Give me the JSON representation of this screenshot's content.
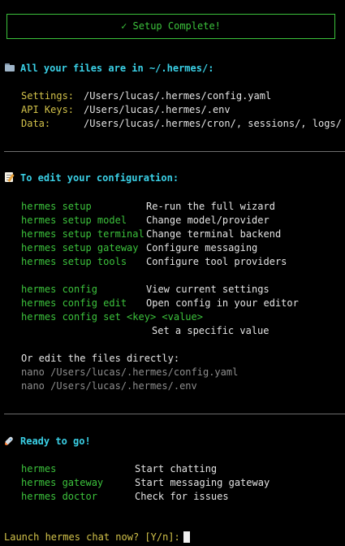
{
  "banner": {
    "text": "✓ Setup Complete!"
  },
  "files": {
    "heading": "All your files are in ~/.hermes/:",
    "icon": "folder-icon",
    "rows": [
      {
        "label": "Settings:",
        "value": "/Users/lucas/.hermes/config.yaml"
      },
      {
        "label": "API Keys:",
        "value": "/Users/lucas/.hermes/.env"
      },
      {
        "label": "Data:",
        "value": "/Users/lucas/.hermes/cron/, sessions/, logs/"
      }
    ]
  },
  "edit": {
    "heading": "To edit your configuration:",
    "icon": "memo-icon",
    "setup_commands": [
      {
        "cmd": "hermes setup",
        "desc": "Re-run the full wizard"
      },
      {
        "cmd": "hermes setup model",
        "desc": "Change model/provider"
      },
      {
        "cmd": "hermes setup terminal",
        "desc": "Change terminal backend"
      },
      {
        "cmd": "hermes setup gateway",
        "desc": "Configure messaging"
      },
      {
        "cmd": "hermes setup tools",
        "desc": "Configure tool providers"
      }
    ],
    "config_commands": [
      {
        "cmd": "hermes config",
        "desc": "View current settings"
      },
      {
        "cmd": "hermes config edit",
        "desc": "Open config in your editor"
      }
    ],
    "config_set": {
      "cmd": "hermes config set <key> <value>",
      "desc": "Set a specific value"
    },
    "direct_note": "Or edit the files directly:",
    "direct_commands": [
      "nano /Users/lucas/.hermes/config.yaml",
      "nano /Users/lucas/.hermes/.env"
    ]
  },
  "ready": {
    "heading": "Ready to go!",
    "icon": "rocket-icon",
    "commands": [
      {
        "cmd": "hermes",
        "desc": "Start chatting"
      },
      {
        "cmd": "hermes gateway",
        "desc": "Start messaging gateway"
      },
      {
        "cmd": "hermes doctor",
        "desc": "Check for issues"
      }
    ]
  },
  "prompt": {
    "text": "Launch hermes chat now? [Y/n]:"
  },
  "colors": {
    "background": "#000000",
    "heading": "#3ad0e6",
    "label": "#d2c24a",
    "command": "#3cc23c",
    "dim": "#8e8e8e"
  }
}
